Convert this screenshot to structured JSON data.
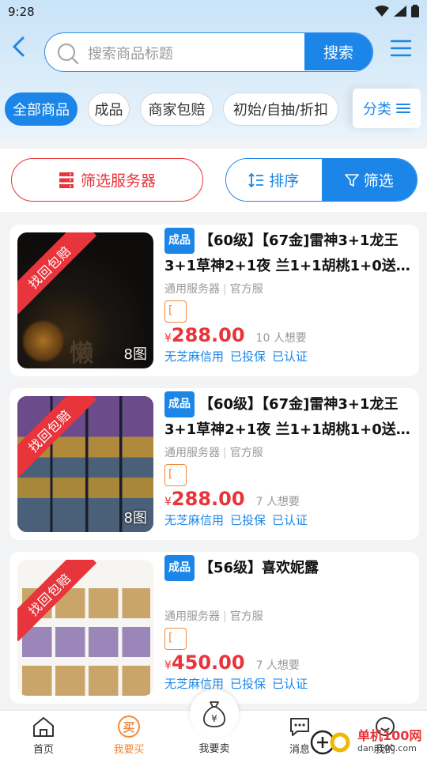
{
  "status_bar": {
    "time": "9:28"
  },
  "search": {
    "placeholder": "搜索商品标题",
    "button": "搜索"
  },
  "chips": [
    "全部商品",
    "成品",
    "商家包赔",
    "初始/自抽/折扣"
  ],
  "category_label": "分类",
  "filter_bar": {
    "server_filter": "筛选服务器",
    "sort": "排序",
    "filter": "筛选"
  },
  "products": [
    {
      "ribbon": "找回包赔",
      "pic_count": "8图",
      "badge": "成品",
      "title": "【60级】【67金]雷神3+1龙王3+1草神2+1夜 兰1+1胡桃1+0送…",
      "server": "通用服务器",
      "channel": "官方服",
      "tag": "[",
      "currency": "¥",
      "price": "288.00",
      "wants": "10 人想要",
      "guarantees": [
        "无芝麻信用",
        "已投保",
        "已认证"
      ]
    },
    {
      "ribbon": "找回包赔",
      "pic_count": "8图",
      "badge": "成品",
      "title": "【60级】【67金]雷神3+1龙王3+1草神2+1夜 兰1+1胡桃1+0送…",
      "server": "通用服务器",
      "channel": "官方服",
      "tag": "[",
      "currency": "¥",
      "price": "288.00",
      "wants": "7 人想要",
      "guarantees": [
        "无芝麻信用",
        "已投保",
        "已认证"
      ]
    },
    {
      "ribbon": "找回包赔",
      "pic_count": "",
      "badge": "成品",
      "title": "【56级】喜欢妮露",
      "server": "通用服务器",
      "channel": "官方服",
      "tag": "[",
      "currency": "¥",
      "price": "450.00",
      "wants": "7 人想要",
      "guarantees": [
        "无芝麻信用",
        "已投保",
        "已认证"
      ]
    }
  ],
  "nav": {
    "home": "首页",
    "buy": "我要买",
    "buy_icon": "买",
    "sell": "我要卖",
    "messages": "消息",
    "mine": "我的"
  },
  "watermark": {
    "line1": "单机100网",
    "line2": "danji100.com"
  },
  "colors": {
    "accent": "#1b86e8",
    "price_red": "#e8343b",
    "active_orange": "#f08a3c"
  }
}
